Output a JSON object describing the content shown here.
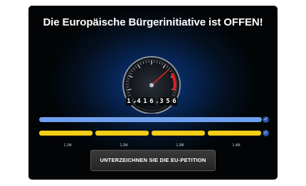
{
  "title": "Die Europäische Bürgerinitiative ist OFFEN!",
  "counter": {
    "digits": [
      "1",
      ".",
      "4",
      "1",
      "6",
      ".",
      "3",
      "5",
      "6"
    ]
  },
  "progress": {
    "main_fraction": 1.0,
    "segments": [
      {
        "label": "1.1M",
        "fill": 1.0
      },
      {
        "label": "1.2M",
        "fill": 1.0
      },
      {
        "label": "1.3M",
        "fill": 1.0
      },
      {
        "label": "1.4M",
        "fill": 1.0
      }
    ],
    "check_icon": "check-icon"
  },
  "cta": {
    "label": "UNTERZEICHNEN SIE DIE EU-PETITION"
  },
  "colors": {
    "accent_blue": "#6fa0ee",
    "accent_yellow": "#f3cd16",
    "needle_red": "#e02020"
  }
}
